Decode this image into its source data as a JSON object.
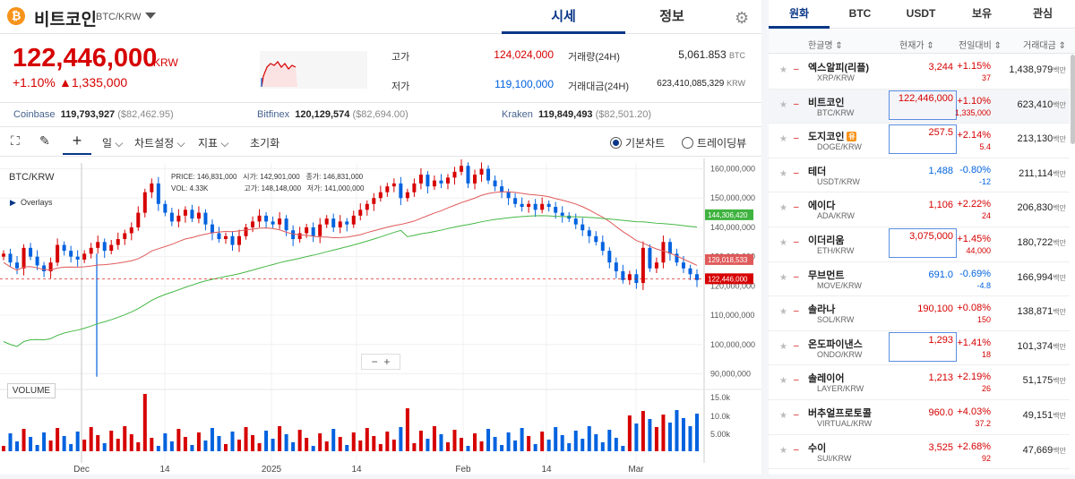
{
  "header": {
    "coin_name": "비트코인",
    "pair": "BTC/KRW",
    "tabs": [
      "시세",
      "정보"
    ]
  },
  "price": {
    "value": "122,446,000",
    "unit": "KRW",
    "change_pct": "+1.10%",
    "change_amt": "▲1,335,000"
  },
  "stats": {
    "high_label": "고가",
    "high": "124,024,000",
    "low_label": "저가",
    "low": "119,100,000",
    "vol_label": "거래량(24H)",
    "vol": "5,061.853",
    "vol_unit": "BTC",
    "val_label": "거래대금(24H)",
    "val": "623,410,085,329",
    "val_unit": "KRW"
  },
  "exchanges": [
    {
      "name": "Coinbase",
      "value": "119,793,927",
      "usd": "($82,462.95)"
    },
    {
      "name": "Bitfinex",
      "value": "120,129,574",
      "usd": "($82,694.00)"
    },
    {
      "name": "Kraken",
      "value": "119,849,493",
      "usd": "($82,501.20)"
    }
  ],
  "toolbar": {
    "interval": "일",
    "chart_settings": "차트설정",
    "indicators": "지표",
    "reset": "초기화",
    "basic_chart": "기본차트",
    "tradingview": "트레이딩뷰"
  },
  "chart_data": {
    "type": "candlestick",
    "symbol": "BTC/KRW",
    "overlays_label": "Overlays",
    "ohlc_labels": {
      "price": "PRICE:",
      "price_v": "146,831,000",
      "vol": "VOL:",
      "vol_v": "4.33K",
      "open": "시가:",
      "open_v": "142,901,000",
      "high": "고가:",
      "high_v": "148,148,000",
      "close": "종가:",
      "close_v": "146,831,000",
      "low": "저가:",
      "low_v": "141,000,000"
    },
    "y_ticks": [
      "160,000,000",
      "150,000,000",
      "140,000,000",
      "130,000,000",
      "120,000,000",
      "110,000,000",
      "100,000,000",
      "90,000,000"
    ],
    "ylim": [
      88000000,
      162000000
    ],
    "ma_labels": [
      "144,306,420",
      "129,018,533",
      "122,446,000"
    ],
    "x_ticks": [
      "Dec",
      "14",
      "2025",
      "14",
      "Feb",
      "14",
      "Mar"
    ],
    "volume_label": "VOLUME",
    "volume_ticks": [
      "15.0k",
      "10.0k",
      "5.00k"
    ],
    "colors": {
      "up": "#d60000",
      "down": "#0062df",
      "ma_short": "#e05a5a",
      "ma_long": "#44b844"
    }
  },
  "market": {
    "tabs": [
      "원화",
      "BTC",
      "USDT",
      "보유",
      "관심"
    ],
    "columns": [
      "한글명",
      "현재가",
      "전일대비",
      "거래대금"
    ],
    "unit": "백만",
    "rows": [
      {
        "name": "엑스알피(리플)",
        "pair": "XRP/KRW",
        "price": "3,244",
        "rate": "+1.15%",
        "diff": "37",
        "value": "1,438,979",
        "dir": "up"
      },
      {
        "name": "비트코인",
        "pair": "BTC/KRW",
        "price": "122,446,000",
        "rate": "+1.10%",
        "diff": "1,335,000",
        "value": "623,410",
        "dir": "up"
      },
      {
        "name": "도지코인",
        "pair": "DOGE/KRW",
        "price": "257.5",
        "rate": "+2.14%",
        "diff": "5.4",
        "value": "213,130",
        "dir": "up"
      },
      {
        "name": "테더",
        "pair": "USDT/KRW",
        "price": "1,488",
        "rate": "-0.80%",
        "diff": "-12",
        "value": "211,114",
        "dir": "down"
      },
      {
        "name": "에이다",
        "pair": "ADA/KRW",
        "price": "1,106",
        "rate": "+2.22%",
        "diff": "24",
        "value": "206,830",
        "dir": "up"
      },
      {
        "name": "이더리움",
        "pair": "ETH/KRW",
        "price": "3,075,000",
        "rate": "+1.45%",
        "diff": "44,000",
        "value": "180,722",
        "dir": "up"
      },
      {
        "name": "무브먼트",
        "pair": "MOVE/KRW",
        "price": "691.0",
        "rate": "-0.69%",
        "diff": "-4.8",
        "value": "166,994",
        "dir": "down"
      },
      {
        "name": "솔라나",
        "pair": "SOL/KRW",
        "price": "190,100",
        "rate": "+0.08%",
        "diff": "150",
        "value": "138,871",
        "dir": "up"
      },
      {
        "name": "온도파이낸스",
        "pair": "ONDO/KRW",
        "price": "1,293",
        "rate": "+1.41%",
        "diff": "18",
        "value": "101,374",
        "dir": "up"
      },
      {
        "name": "솔레이어",
        "pair": "LAYER/KRW",
        "price": "1,213",
        "rate": "+2.19%",
        "diff": "26",
        "value": "51,175",
        "dir": "up"
      },
      {
        "name": "버추얼프로토콜",
        "pair": "VIRTUAL/KRW",
        "price": "960.0",
        "rate": "+4.03%",
        "diff": "37.2",
        "value": "49,151",
        "dir": "up"
      },
      {
        "name": "수이",
        "pair": "SUI/KRW",
        "price": "3,525",
        "rate": "+2.68%",
        "diff": "92",
        "value": "47,669",
        "dir": "up"
      }
    ]
  }
}
